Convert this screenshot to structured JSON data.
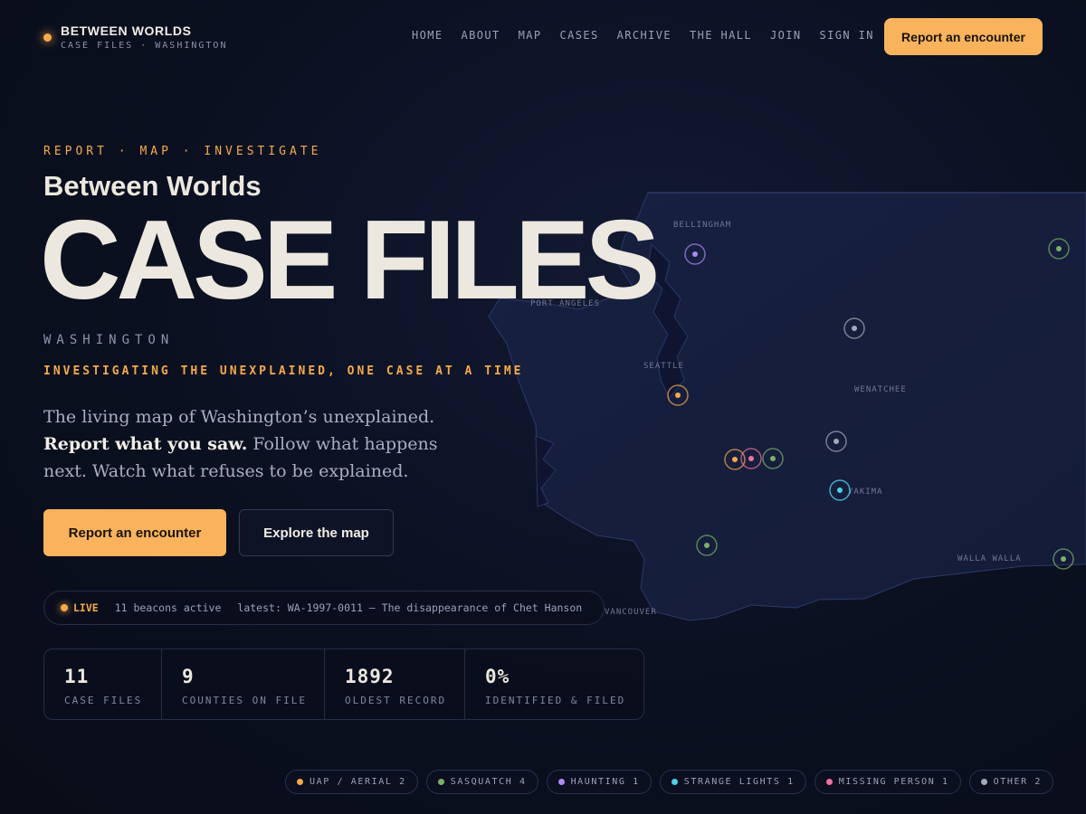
{
  "brand": {
    "title": "BETWEEN WORLDS",
    "subtitle": "CASE FILES · WASHINGTON"
  },
  "nav": [
    "HOME",
    "ABOUT",
    "MAP",
    "CASES",
    "ARCHIVE",
    "THE HALL",
    "JOIN",
    "SIGN IN"
  ],
  "header_cta": "Report an encounter",
  "hero": {
    "eyebrow": "REPORT · MAP · INVESTIGATE",
    "subtitle": "Between Worlds",
    "title": "CASE FILES",
    "region": "WASHINGTON",
    "tagline": "INVESTIGATING THE UNEXPLAINED, ONE CASE AT A TIME",
    "intro_a": "The living map of Washington’s unexplained. ",
    "intro_b": "Report what you saw.",
    "intro_c": " Follow what happens next. Watch what refuses to be explained.",
    "primary_button": "Report an encounter",
    "secondary_button": "Explore the map"
  },
  "live": {
    "label": "LIVE",
    "count": "11 beacons active",
    "latest": "latest: WA-1997-0011 — The disappearance of Chet Hanson"
  },
  "stats": [
    {
      "value": "11",
      "label": "CASE FILES"
    },
    {
      "value": "9",
      "label": "COUNTIES ON FILE"
    },
    {
      "value": "1892",
      "label": "OLDEST RECORD"
    },
    {
      "value": "0%",
      "label": "IDENTIFIED & FILED"
    }
  ],
  "map": {
    "cities": [
      "BELLINGHAM",
      "PORT ANGELES",
      "SEATTLE",
      "WENATCHEE",
      "YAKIMA",
      "WALLA WALLA",
      "VANCOUVER"
    ]
  },
  "legend": [
    {
      "label": "UAP / AERIAL 2",
      "color": "#f6a94b"
    },
    {
      "label": "SASQUATCH 4",
      "color": "#7bb069"
    },
    {
      "label": "HAUNTING 1",
      "color": "#a98bf2"
    },
    {
      "label": "STRANGE LIGHTS 1",
      "color": "#4fd0e6"
    },
    {
      "label": "MISSING PERSON 1",
      "color": "#f06fa0"
    },
    {
      "label": "OTHER 2",
      "color": "#a4a9b8"
    }
  ],
  "colors": {
    "accent": "#f9b35c",
    "background": "#0b1020"
  }
}
